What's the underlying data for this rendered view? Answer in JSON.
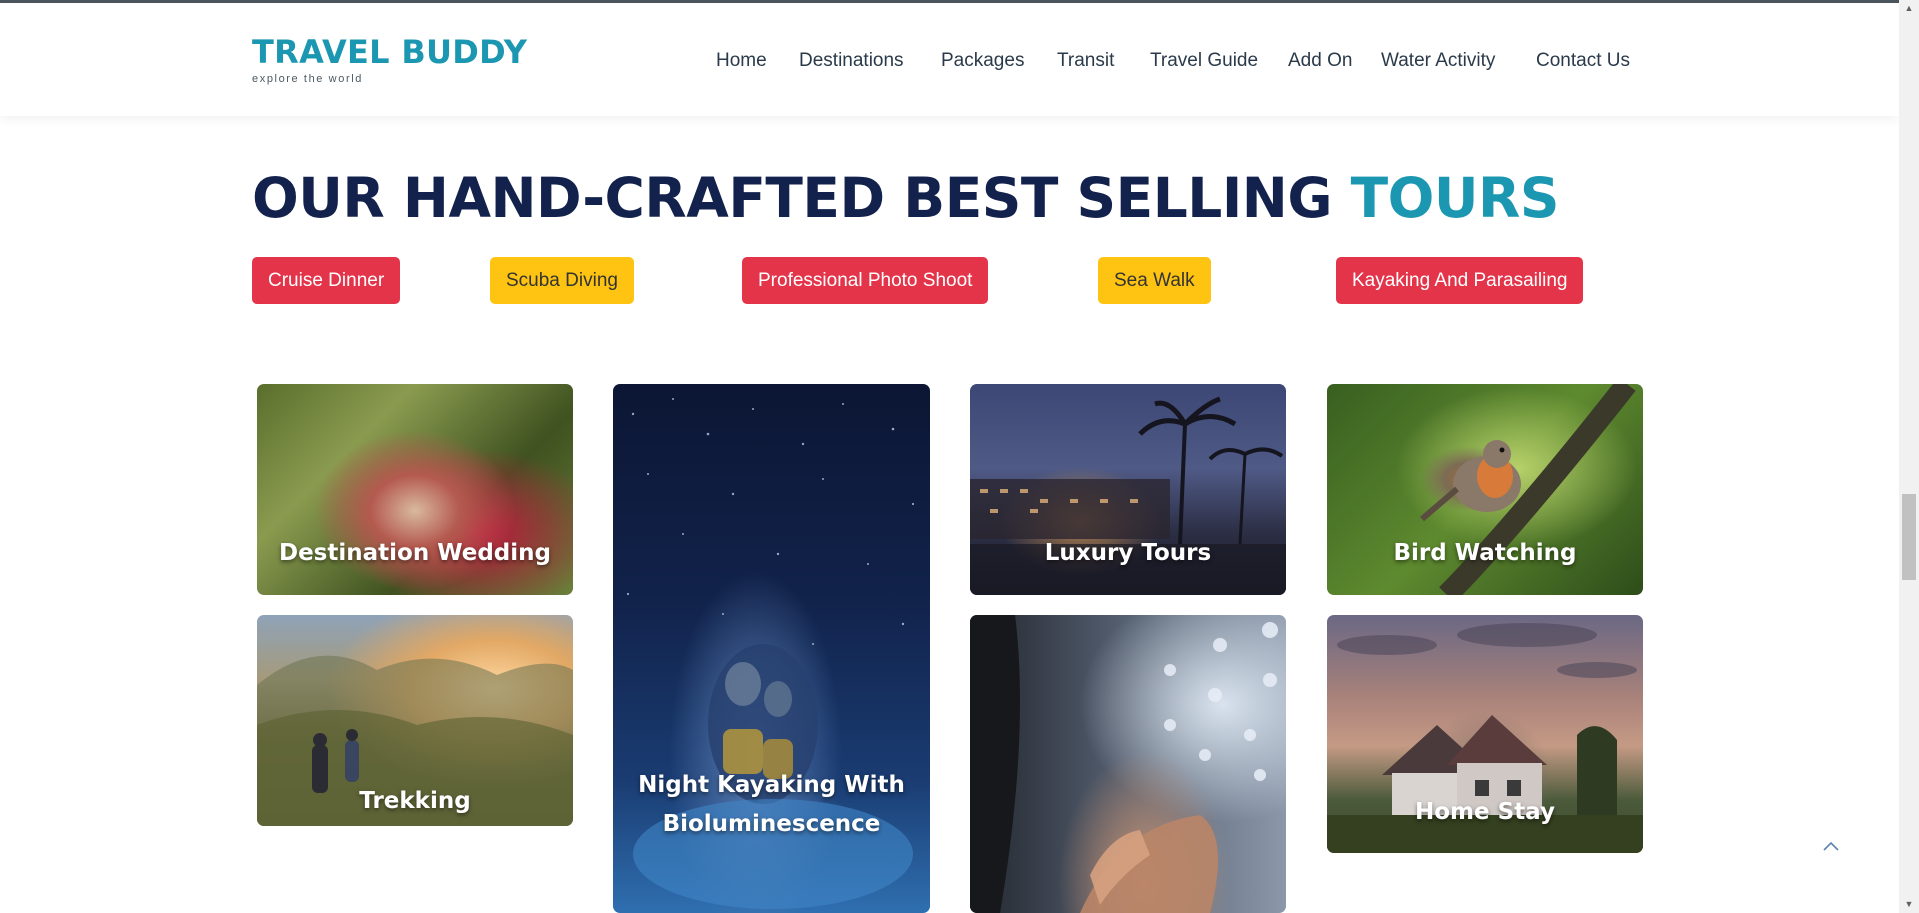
{
  "brand": {
    "title": "TRAVEL BUDDY",
    "subtitle": "explore the world",
    "color": "#1c97b1"
  },
  "nav": {
    "items": [
      "Home",
      "Destinations",
      "Packages",
      "Transit",
      "Travel Guide",
      "Add On",
      "Water Activity",
      "Contact Us"
    ]
  },
  "section": {
    "heading_main": "OUR HAND-CRAFTED BEST SELLING ",
    "heading_accent": "TOURS"
  },
  "tags": [
    {
      "label": "Cruise Dinner",
      "style": "red"
    },
    {
      "label": "Scuba Diving",
      "style": "yellow"
    },
    {
      "label": "Professional Photo Shoot",
      "style": "red"
    },
    {
      "label": "Sea Walk",
      "style": "yellow"
    },
    {
      "label": "Kayaking And Parasailing",
      "style": "red"
    }
  ],
  "cards": {
    "wedding": "Destination Wedding",
    "kayak": "Night Kayaking With Bioluminescence",
    "luxury": "Luxury Tours",
    "bird": "Bird Watching",
    "trek": "Trekking",
    "spa": "",
    "home": "Home Stay"
  },
  "colors": {
    "navy": "#13224d",
    "accent": "#1c97b1",
    "tag_red": "#e3344a",
    "tag_yellow": "#fec411"
  },
  "icons": {
    "back_to_top": "chevron-up-icon"
  }
}
